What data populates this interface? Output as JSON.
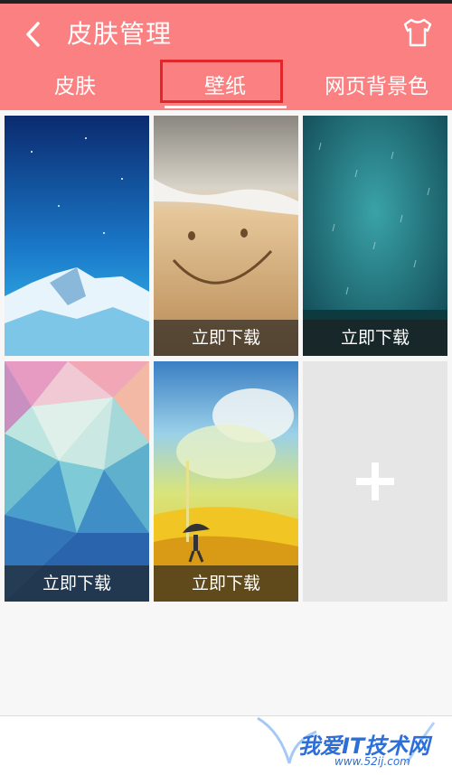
{
  "header": {
    "title": "皮肤管理",
    "back_icon": "chevron-left-icon",
    "skin_icon": "tshirt-icon"
  },
  "tabs": [
    {
      "label": "皮肤"
    },
    {
      "label": "壁纸"
    },
    {
      "label": "网页背景色"
    }
  ],
  "active_tab": 1,
  "wallpapers": [
    {
      "theme": "snowy-mountain-night",
      "download_label": ""
    },
    {
      "theme": "beach-smiley",
      "download_label": "立即下载"
    },
    {
      "theme": "rain-teal",
      "download_label": "立即下载"
    },
    {
      "theme": "pastel-polygons",
      "download_label": "立即下载"
    },
    {
      "theme": "cartoon-umbrella-field",
      "download_label": "立即下载"
    }
  ],
  "add_button_icon": "plus-icon",
  "watermark": {
    "text": "我爱IT技术网",
    "url": "www.52ij.com"
  },
  "colors": {
    "header": "#fb8081",
    "highlight": "#e3262a"
  }
}
